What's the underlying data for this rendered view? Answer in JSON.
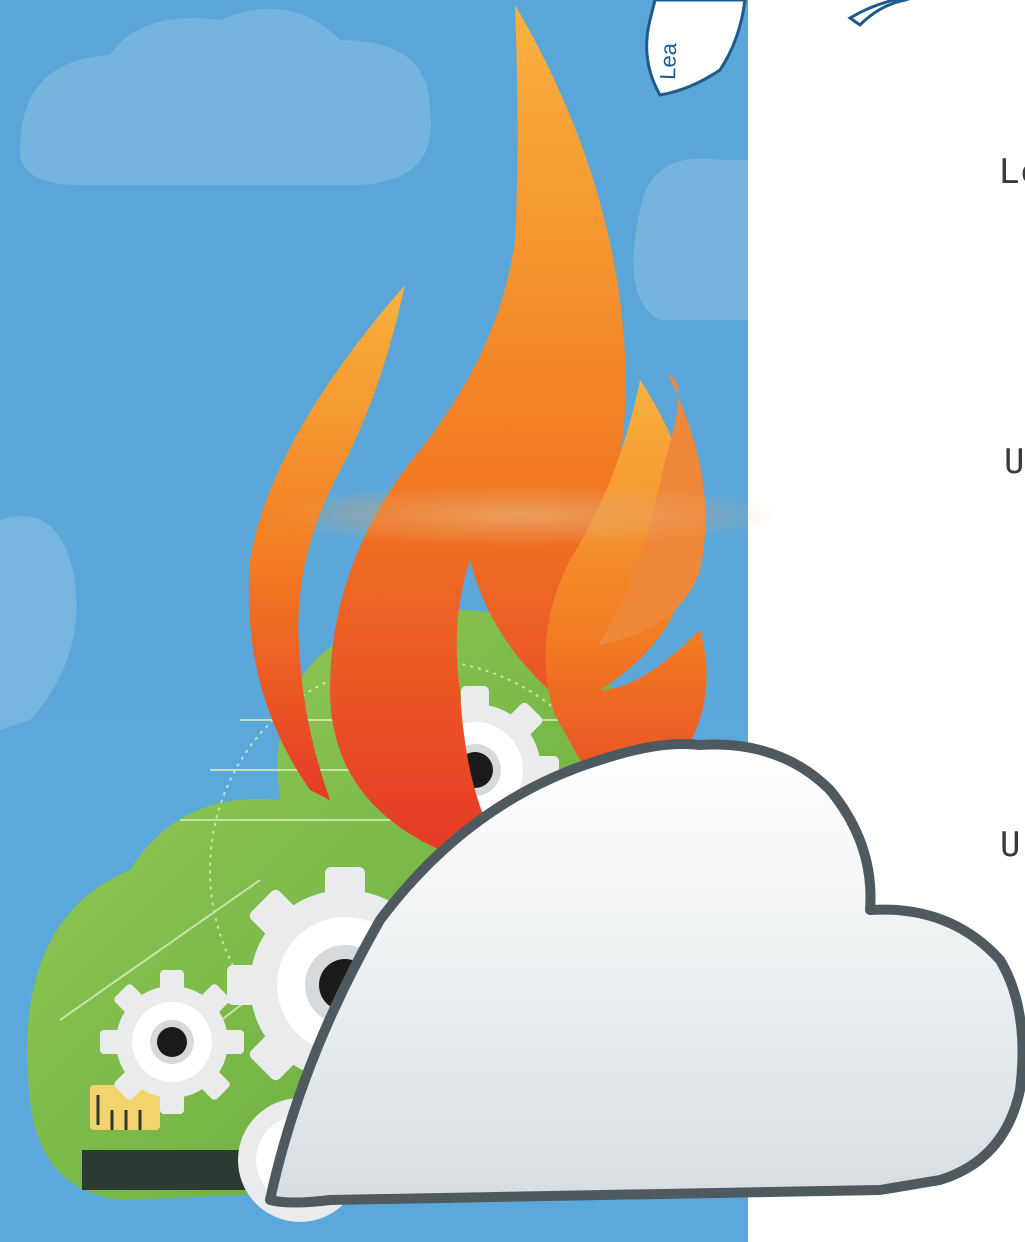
{
  "book_label": "Lea",
  "side_text": [
    "Le",
    "U",
    "U"
  ],
  "colors": {
    "sky": "#5ba7d9",
    "flame_top": "#f7a93a",
    "flame_bottom": "#e83a2a",
    "circuit_green": "#7fbf4a",
    "cloud_fill": "#eef1f3",
    "cloud_outline": "#4f5a60"
  }
}
